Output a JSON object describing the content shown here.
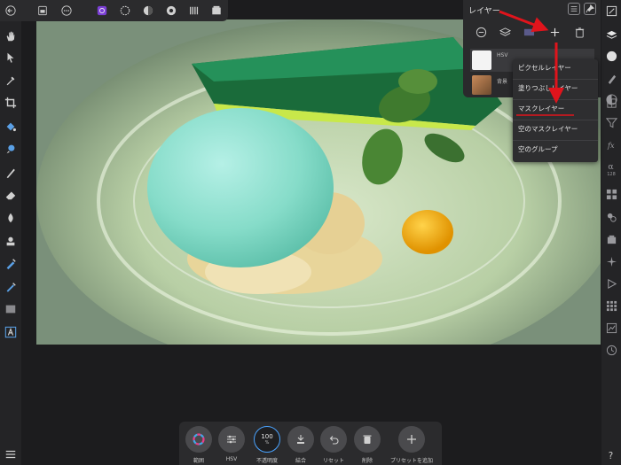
{
  "layers_panel": {
    "title": "レイヤー",
    "layer1_name": "HSV",
    "layer2_name": "背景"
  },
  "dropdown": {
    "items": [
      "ピクセルレイヤー",
      "塗りつぶしレイヤー",
      "マスクレイヤー",
      "空のマスクレイヤー",
      "空のグループ"
    ]
  },
  "bottom_bar": {
    "buttons": [
      {
        "label": "範囲",
        "icon": "color-wheel-icon"
      },
      {
        "label": "HSV",
        "icon": "sliders-icon"
      },
      {
        "label": "不透明度",
        "icon": "opacity-icon",
        "value": "100",
        "unit": "%"
      },
      {
        "label": "結合",
        "icon": "merge-icon"
      },
      {
        "label": "リセット",
        "icon": "undo-icon"
      },
      {
        "label": "削除",
        "icon": "trash-icon"
      },
      {
        "label": "プリセットを追加",
        "icon": "plus-icon"
      }
    ]
  },
  "right_bar": {
    "label_128": "128"
  },
  "colors": {
    "accent_red": "#e0141c",
    "panel_bg": "#2a2a2c",
    "highlight_purple": "#7b3fd6"
  }
}
